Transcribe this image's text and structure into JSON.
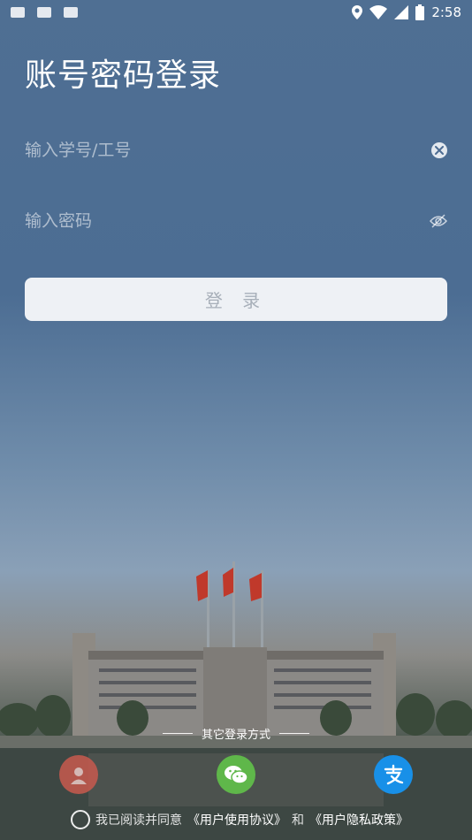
{
  "status_bar": {
    "time": "2:58",
    "left_icons": [
      "keyboard-icon",
      "sd-card-icon",
      "font-icon"
    ],
    "right_icons": [
      "location-icon",
      "wifi-icon",
      "signal-icon",
      "battery-icon"
    ]
  },
  "page": {
    "title": "账号密码登录"
  },
  "form": {
    "account_placeholder": "输入学号/工号",
    "account_value": "",
    "password_placeholder": "输入密码",
    "password_value": "",
    "login_label": "登 录"
  },
  "other_login": {
    "title": "其它登录方式",
    "methods": [
      {
        "name": "face",
        "icon": "face-icon",
        "color": "#c85a4e"
      },
      {
        "name": "wechat",
        "icon": "wechat-icon",
        "color": "#5fb74a"
      },
      {
        "name": "alipay",
        "icon": "alipay-icon",
        "color": "#1890e8"
      }
    ]
  },
  "agreement": {
    "prefix": "我已阅读并同意",
    "user_agreement": "《用户使用协议》",
    "and": "和",
    "privacy_policy": "《用户隐私政策》"
  }
}
